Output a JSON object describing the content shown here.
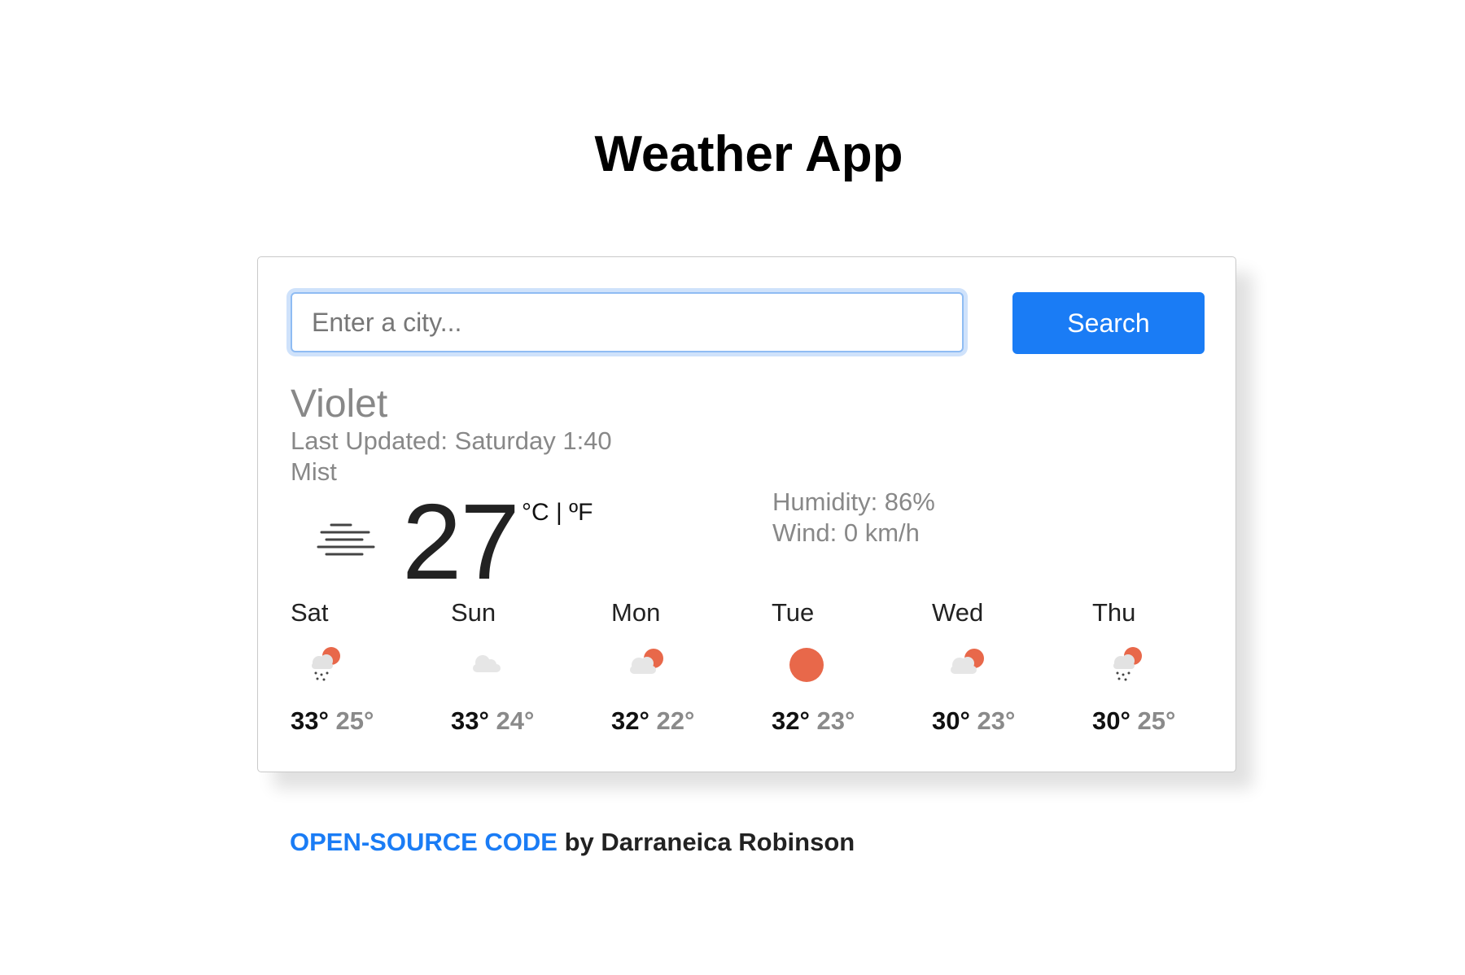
{
  "header": {
    "title": "Weather App"
  },
  "search": {
    "placeholder": "Enter a city...",
    "value": "",
    "button_label": "Search"
  },
  "current": {
    "city": "Violet",
    "last_updated": "Last Updated: Saturday 1:40",
    "condition": "Mist",
    "icon": "mist-icon",
    "temperature": "27",
    "unit_celsius": "°C",
    "unit_separator": " | ",
    "unit_fahrenheit": "ºF",
    "humidity": "Humidity: 86%",
    "wind": "Wind: 0 km/h"
  },
  "forecast": [
    {
      "day": "Sat",
      "icon": "rain-sun-icon",
      "max": "33°",
      "min": "25°"
    },
    {
      "day": "Sun",
      "icon": "cloud-icon",
      "max": "33°",
      "min": "24°"
    },
    {
      "day": "Mon",
      "icon": "partly-cloudy-icon",
      "max": "32°",
      "min": "22°"
    },
    {
      "day": "Tue",
      "icon": "sun-icon",
      "max": "32°",
      "min": "23°"
    },
    {
      "day": "Wed",
      "icon": "partly-cloudy-icon",
      "max": "30°",
      "min": "23°"
    },
    {
      "day": "Thu",
      "icon": "rain-sun-icon",
      "max": "30°",
      "min": "25°"
    }
  ],
  "footer": {
    "link_text": "OPEN-SOURCE CODE",
    "credit_text": " by Darraneica Robinson"
  },
  "colors": {
    "accent": "#1a7cf5",
    "sun": "#e8684a",
    "cloud": "#e6e6e6",
    "muted_text": "#888888"
  }
}
